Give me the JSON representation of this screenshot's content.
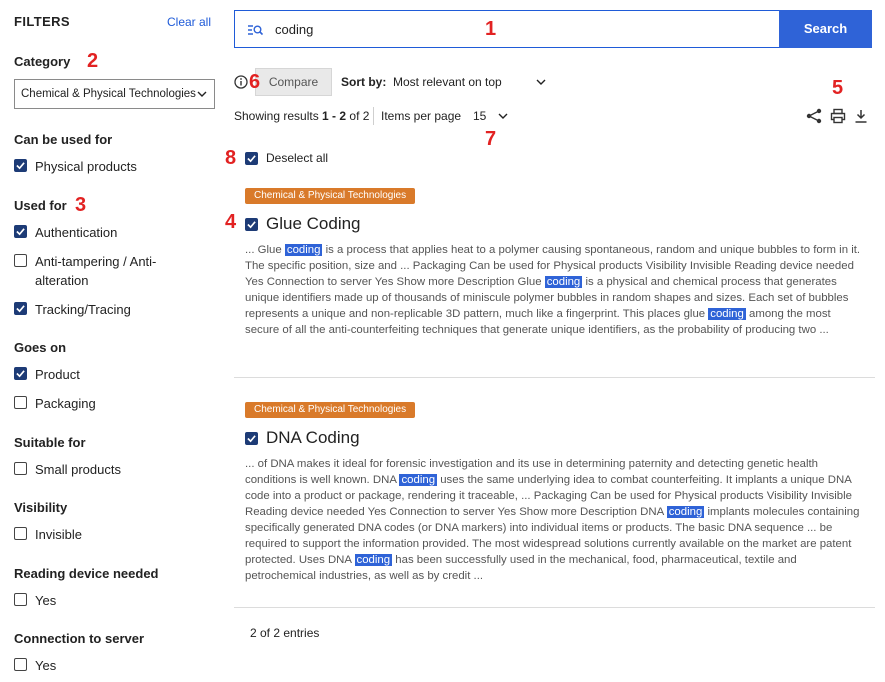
{
  "sidebar": {
    "title": "FILTERS",
    "clear_all": "Clear all",
    "category": {
      "title": "Category",
      "selected": "Chemical & Physical Technologies"
    },
    "can_be_used_for": {
      "title": "Can be used for",
      "options": [
        {
          "label": "Physical products",
          "checked": true
        }
      ]
    },
    "used_for": {
      "title": "Used for",
      "options": [
        {
          "label": "Authentication",
          "checked": true
        },
        {
          "label": "Anti-tampering / Anti-",
          "label2": "alteration",
          "checked": false
        },
        {
          "label": "Tracking/Tracing",
          "checked": true
        }
      ]
    },
    "goes_on": {
      "title": "Goes on",
      "options": [
        {
          "label": "Product",
          "checked": true
        },
        {
          "label": "Packaging",
          "checked": false
        }
      ]
    },
    "suitable_for": {
      "title": "Suitable for",
      "options": [
        {
          "label": "Small products",
          "checked": false
        }
      ]
    },
    "visibility": {
      "title": "Visibility",
      "options": [
        {
          "label": "Invisible",
          "checked": false
        }
      ]
    },
    "reading_device": {
      "title": "Reading device needed",
      "options": [
        {
          "label": "Yes",
          "checked": false
        }
      ]
    },
    "connection": {
      "title": "Connection to server",
      "options": [
        {
          "label": "Yes",
          "checked": false
        }
      ]
    }
  },
  "search": {
    "value": "coding",
    "button": "Search",
    "icon": "search-list-icon"
  },
  "toolbar": {
    "compare": "Compare",
    "sort_label": "Sort by:",
    "sort_value": "Most relevant on top",
    "showing_prefix": "Showing results ",
    "showing_range": "1 - 2",
    "showing_suffix": " of 2",
    "items_per_page_label": "Items per page",
    "items_per_page_value": "15",
    "icons": [
      "share-icon",
      "print-icon",
      "download-icon"
    ]
  },
  "deselect_all": "Deselect all",
  "results": [
    {
      "tag": "Chemical & Physical Technologies",
      "title": "Glue Coding",
      "checked": true,
      "desc": [
        "... Glue ",
        "coding",
        " is a process that applies heat to a polymer causing spontaneous, random and unique bubbles to form in it. The specific position, size and ... Packaging Can be used for Physical products Visibility Invisible Reading device needed Yes Connection to server Yes Show more Description Glue ",
        "coding",
        " is a physical and chemical process that generates unique identifiers made up of thousands of miniscule polymer bubbles in random shapes and sizes. Each set of bubbles represents a unique and non-replicable 3D pattern, much like a fingerprint. This places glue ",
        "coding",
        " among the most secure of all the anti-counterfeiting techniques that generate unique identifiers, as the probability of producing two ..."
      ]
    },
    {
      "tag": "Chemical & Physical Technologies",
      "title": "DNA Coding",
      "checked": true,
      "desc": [
        "... of DNA makes it ideal for forensic investigation and its use in determining paternity and detecting genetic health conditions is well known. DNA ",
        "coding",
        " uses the same underlying idea to combat counterfeiting. It implants a unique DNA code into a product or package, rendering it traceable, ... Packaging Can be used for Physical products Visibility Invisible Reading device needed Yes Connection to server Yes Show more Description DNA ",
        "coding",
        " implants molecules containing specifically generated DNA codes (or DNA markers) into individual items or products. The basic DNA sequence ... be required to support the information provided.  The most widespread solutions currently available on the market are patent protected. Uses DNA ",
        "coding",
        " has been successfully used in the mechanical, food, pharmaceutical, textile and petrochemical industries, as well as by credit ..."
      ]
    }
  ],
  "footer": {
    "entries": "2 of 2 entries"
  },
  "annotations": [
    "1",
    "2",
    "3",
    "4",
    "5",
    "6",
    "7",
    "8"
  ],
  "colors": {
    "accent": "#2f63d7",
    "tag": "#d97a2a",
    "checkbox": "#1d3b76",
    "annotation": "#e22222"
  }
}
